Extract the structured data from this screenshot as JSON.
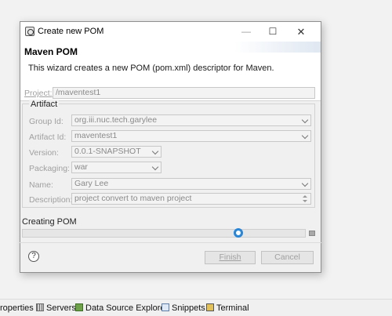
{
  "dialog": {
    "window_title": "Create new POM",
    "header_title": "Maven POM",
    "header_description": "This wizard creates a new POM (pom.xml) descriptor for Maven."
  },
  "form": {
    "project_label": "Project:",
    "project_value": "/maventest1",
    "group_title": "Artifact",
    "group_id_label": "Group Id:",
    "group_id_value": "org.iii.nuc.tech.garylee",
    "artifact_id_label": "Artifact Id:",
    "artifact_id_value": "maventest1",
    "version_label": "Version:",
    "version_value": "0.0.1-SNAPSHOT",
    "packaging_label": "Packaging:",
    "packaging_value": "war",
    "name_label": "Name:",
    "name_value": "Gary Lee",
    "description_label": "Description:",
    "description_value": "project convert to maven project"
  },
  "progress": {
    "label": "Creating POM"
  },
  "footer": {
    "help_glyph": "?",
    "finish_label": "Finish",
    "cancel_label": "Cancel"
  },
  "tabs": [
    {
      "label": "roperties",
      "icon": "properties-icon"
    },
    {
      "label": "Servers",
      "icon": "servers-icon"
    },
    {
      "label": "Data Source Explorer",
      "icon": "data-source-explorer-icon"
    },
    {
      "label": "Snippets",
      "icon": "snippets-icon"
    },
    {
      "label": "Terminal",
      "icon": "terminal-icon"
    }
  ]
}
